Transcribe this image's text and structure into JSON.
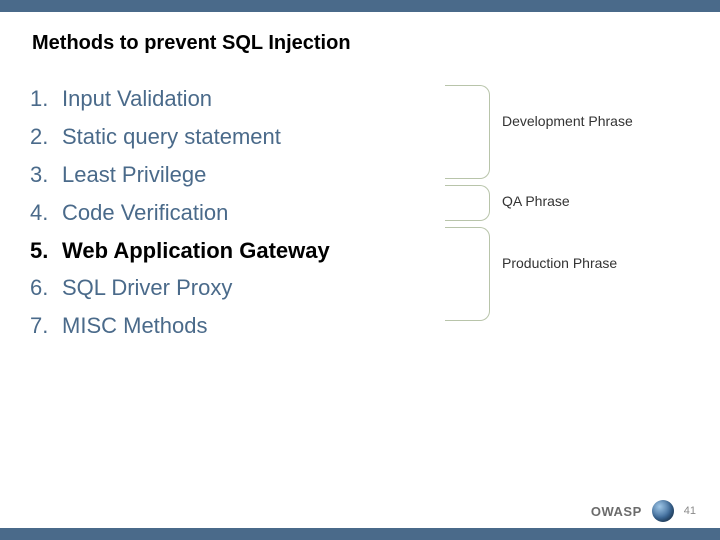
{
  "title": "Methods to prevent SQL Injection",
  "methods": [
    {
      "n": "1.",
      "text": "Input Validation",
      "highlight": false
    },
    {
      "n": "2.",
      "text": "Static query statement",
      "highlight": false
    },
    {
      "n": "3.",
      "text": "Least Privilege",
      "highlight": false
    },
    {
      "n": "4.",
      "text": "Code Verification",
      "highlight": false
    },
    {
      "n": "5.",
      "text": "Web Application Gateway",
      "highlight": true
    },
    {
      "n": "6.",
      "text": "SQL Driver Proxy",
      "highlight": false
    },
    {
      "n": "7.",
      "text": "MISC Methods",
      "highlight": false
    }
  ],
  "phases": {
    "dev": "Development Phrase",
    "qa": "QA Phrase",
    "prod": "Production Phrase"
  },
  "footer": {
    "org": "OWASP",
    "page": "41"
  }
}
